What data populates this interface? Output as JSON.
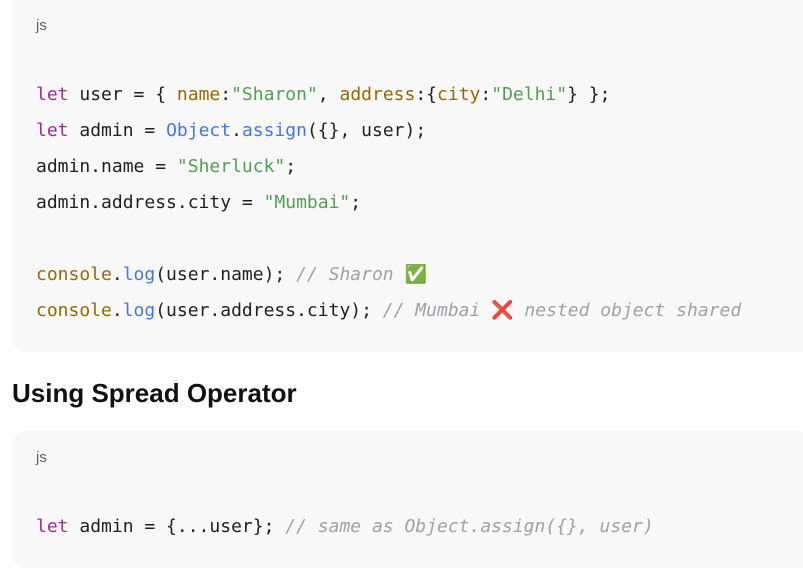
{
  "block1": {
    "lang": "js",
    "line1": {
      "kw": "let",
      "pre": " user = { ",
      "p1": "name",
      "s1": ":",
      "v1": "\"Sharon\"",
      "s2": ", ",
      "p2": "address",
      "s3": ":{",
      "p3": "city",
      "s4": ":",
      "v2": "\"Delhi\"",
      "s5": "} };"
    },
    "line2": {
      "kw": "let",
      "pre": " admin = ",
      "obj": "Object",
      "dot": ".",
      "fn": "assign",
      "post": "({}, user);"
    },
    "line3": {
      "pre": "admin.name = ",
      "str": "\"Sherluck\"",
      "post": ";"
    },
    "line4": {
      "pre": "admin.address.city = ",
      "str": "\"Mumbai\"",
      "post": ";"
    },
    "line5": {
      "obj": "console",
      "dot": ".",
      "fn": "log",
      "post": "(user.name); ",
      "cmt": "// Sharon ",
      "emoji": "✅"
    },
    "line6": {
      "obj": "console",
      "dot": ".",
      "fn": "log",
      "post": "(user.address.city); ",
      "cmt1": "// Mumbai ",
      "emoji": "❌",
      "cmt2": " nested object shared"
    }
  },
  "section_heading": "Using Spread Operator",
  "block2": {
    "lang": "js",
    "line1": {
      "kw": "let",
      "pre": " admin = {...user}; ",
      "cmt": "// same as Object.assign({}, user)"
    }
  },
  "colors": {
    "keyword": "#a626a4",
    "property": "#986801",
    "string": "#50a14f",
    "function": "#4078f2",
    "comment": "#a0a1a7",
    "code_bg": "#f8f8f8"
  }
}
